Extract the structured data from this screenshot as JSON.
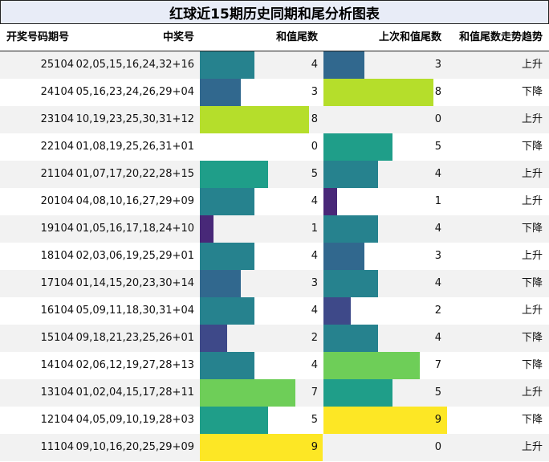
{
  "title": "红球近15期历史同期和尾分析图表",
  "headers": {
    "issue": "开奖号码期号",
    "numbers": "中奖号",
    "tail": "和值尾数",
    "prev_tail": "上次和值尾数",
    "trend": "和值尾数走势趋势"
  },
  "chart_data": {
    "type": "table",
    "title": "红球近15期历史同期和尾分析图表",
    "columns": [
      "开奖号码期号",
      "中奖号",
      "和值尾数",
      "上次和值尾数",
      "和值尾数走势趋势"
    ],
    "value_range": [
      0,
      9
    ],
    "rows": [
      {
        "issue": "25104",
        "numbers": "02,05,15,16,24,32+16",
        "tail": 4,
        "prev_tail": 3,
        "trend": "上升"
      },
      {
        "issue": "24104",
        "numbers": "05,16,23,24,26,29+04",
        "tail": 3,
        "prev_tail": 8,
        "trend": "下降"
      },
      {
        "issue": "23104",
        "numbers": "10,19,23,25,30,31+12",
        "tail": 8,
        "prev_tail": 0,
        "trend": "上升"
      },
      {
        "issue": "22104",
        "numbers": "01,08,19,25,26,31+01",
        "tail": 0,
        "prev_tail": 5,
        "trend": "下降"
      },
      {
        "issue": "21104",
        "numbers": "01,07,17,20,22,28+15",
        "tail": 5,
        "prev_tail": 4,
        "trend": "上升"
      },
      {
        "issue": "20104",
        "numbers": "04,08,10,16,27,29+09",
        "tail": 4,
        "prev_tail": 1,
        "trend": "上升"
      },
      {
        "issue": "19104",
        "numbers": "01,05,16,17,18,24+10",
        "tail": 1,
        "prev_tail": 4,
        "trend": "下降"
      },
      {
        "issue": "18104",
        "numbers": "02,03,06,19,25,29+01",
        "tail": 4,
        "prev_tail": 3,
        "trend": "上升"
      },
      {
        "issue": "17104",
        "numbers": "01,14,15,20,23,30+14",
        "tail": 3,
        "prev_tail": 4,
        "trend": "下降"
      },
      {
        "issue": "16104",
        "numbers": "05,09,11,18,30,31+04",
        "tail": 4,
        "prev_tail": 2,
        "trend": "上升"
      },
      {
        "issue": "15104",
        "numbers": "09,18,21,23,25,26+01",
        "tail": 2,
        "prev_tail": 4,
        "trend": "下降"
      },
      {
        "issue": "14104",
        "numbers": "02,06,12,19,27,28+13",
        "tail": 4,
        "prev_tail": 7,
        "trend": "下降"
      },
      {
        "issue": "13104",
        "numbers": "01,02,04,15,17,28+11",
        "tail": 7,
        "prev_tail": 5,
        "trend": "上升"
      },
      {
        "issue": "12104",
        "numbers": "04,05,09,10,19,28+03",
        "tail": 5,
        "prev_tail": 9,
        "trend": "下降"
      },
      {
        "issue": "11104",
        "numbers": "09,10,16,20,25,29+09",
        "tail": 9,
        "prev_tail": 0,
        "trend": "上升"
      }
    ]
  },
  "colors": {
    "0": "#ffffff",
    "1": "#482878",
    "2": "#3e4989",
    "3": "#31688e",
    "4": "#26828e",
    "5": "#1f9e89",
    "7": "#6ece58",
    "8": "#b5de2b",
    "9": "#fde725"
  }
}
